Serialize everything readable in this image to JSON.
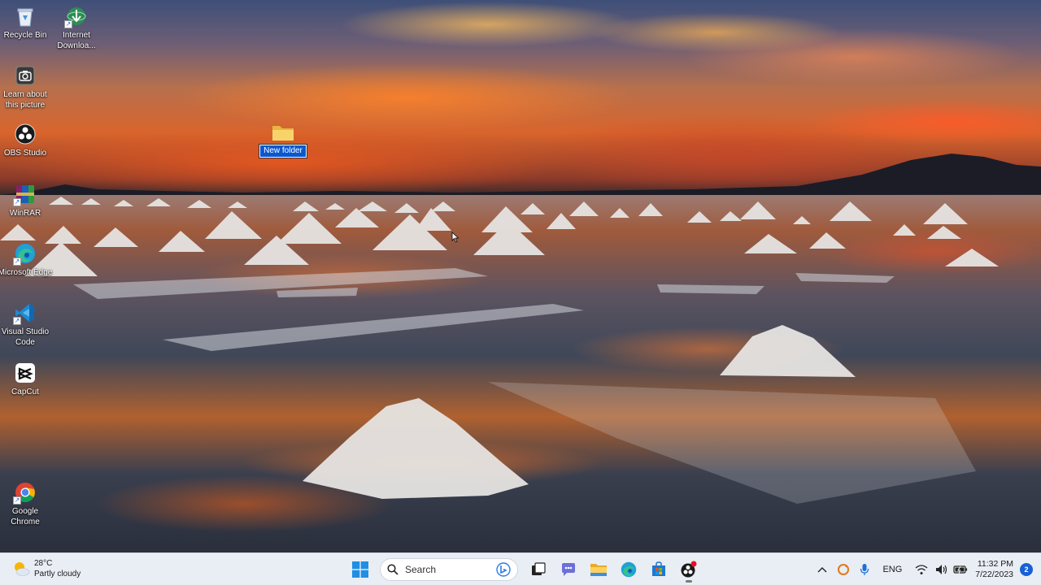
{
  "desktop": {
    "icons": [
      {
        "label": "Recycle Bin"
      },
      {
        "label": "Internet Downloa..."
      },
      {
        "label": "Learn about this picture"
      },
      {
        "label": "OBS Studio"
      },
      {
        "label": "WinRAR"
      },
      {
        "label": "Microsoft Edge"
      },
      {
        "label": "Visual Studio Code"
      },
      {
        "label": "CapCut"
      },
      {
        "label": "Google Chrome"
      }
    ],
    "new_folder": {
      "name": "New folder",
      "state": "renaming"
    }
  },
  "taskbar": {
    "weather": {
      "temp": "28°C",
      "condition": "Partly cloudy",
      "icon": "partly-cloudy-icon"
    },
    "search": {
      "placeholder": "Search"
    },
    "pinned": [
      "start-icon",
      "task-view-icon",
      "teams-chat-icon",
      "file-explorer-icon",
      "edge-icon",
      "store-icon",
      "obs-icon"
    ],
    "tray": {
      "language": "ENG",
      "time": "11:32 PM",
      "date": "7/22/2023",
      "notifications": "2"
    }
  },
  "colors": {
    "taskbar_bg": "#e9edf4",
    "selection_blue": "#0a58d0",
    "accent": "#1760d6"
  }
}
